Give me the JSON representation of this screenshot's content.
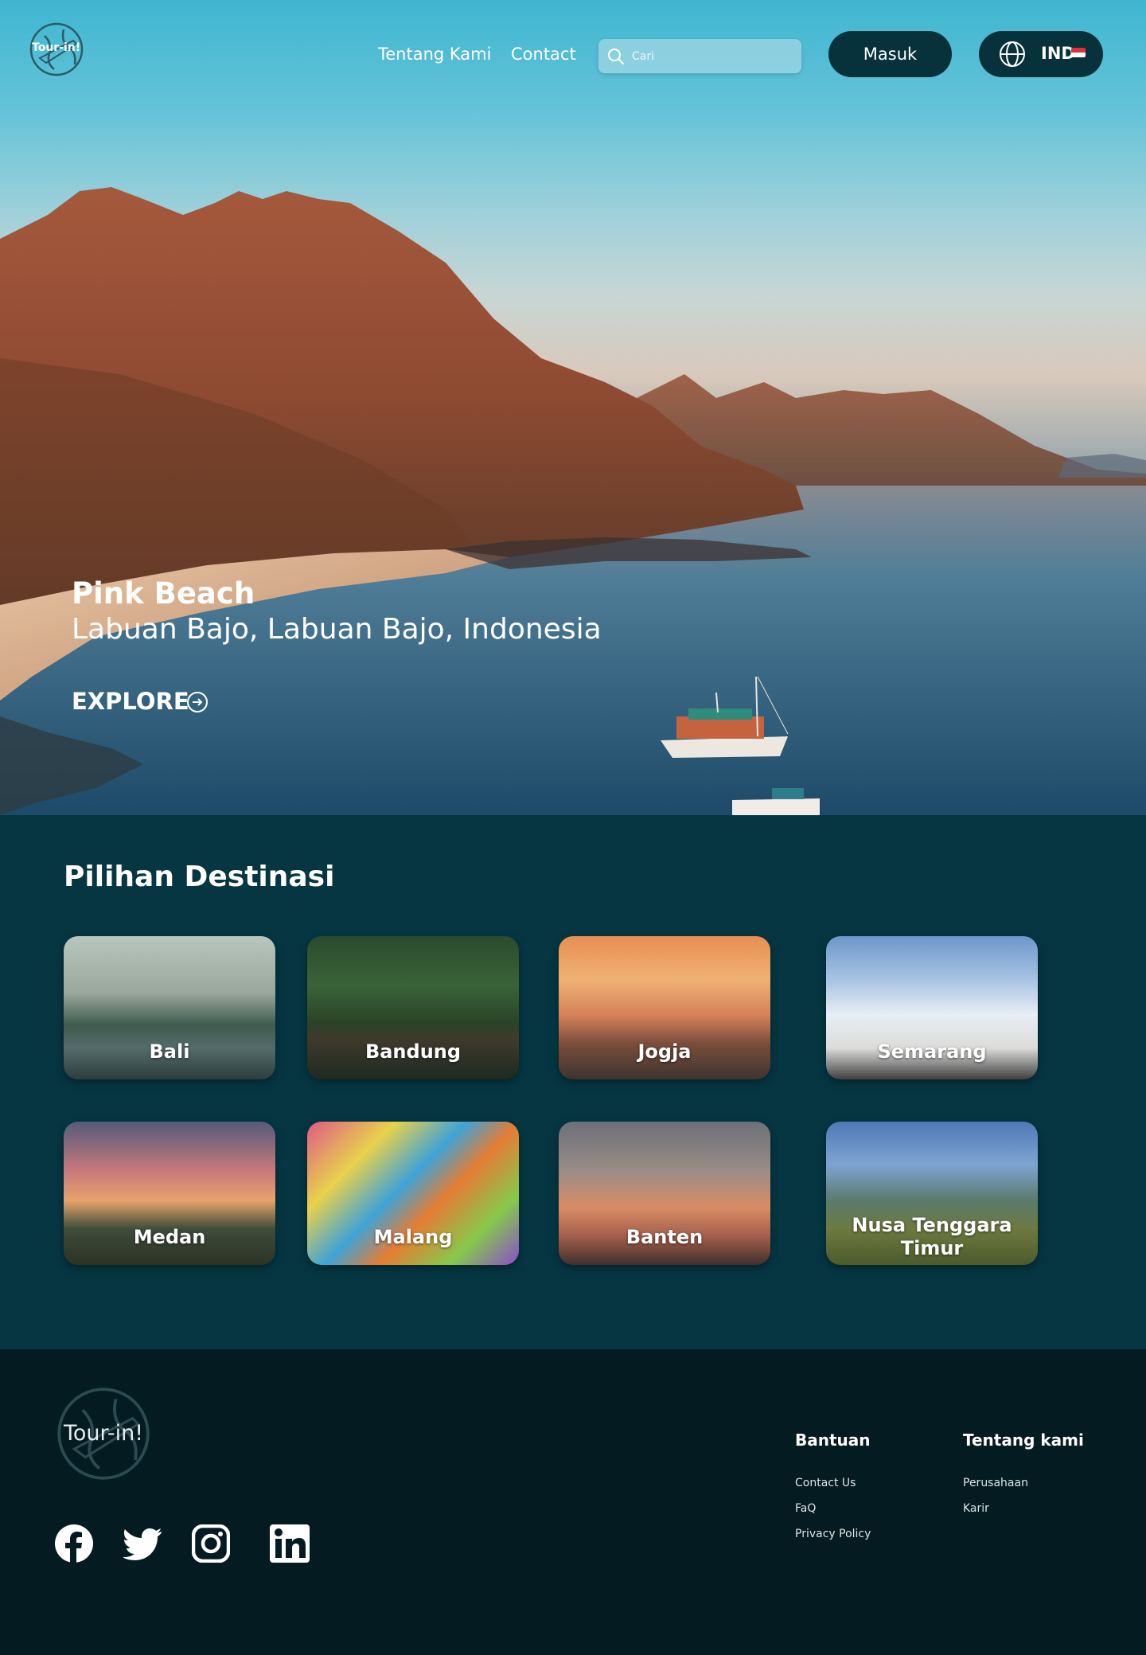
{
  "header": {
    "brand": "Tour-in!",
    "nav": [
      {
        "label": "Tentang Kami"
      },
      {
        "label": "Contact"
      }
    ],
    "search_placeholder": "Cari",
    "login_label": "Masuk",
    "language_label": "IND"
  },
  "hero": {
    "title": "Pink Beach",
    "location": "Labuan Bajo, Labuan Bajo, Indonesia",
    "cta": "EXPLORE"
  },
  "destinations": {
    "title": "Pilihan Destinasi",
    "items": [
      {
        "name": "Bali"
      },
      {
        "name": "Bandung"
      },
      {
        "name": "Jogja"
      },
      {
        "name": "Semarang"
      },
      {
        "name": "Medan"
      },
      {
        "name": "Malang"
      },
      {
        "name": "Banten"
      },
      {
        "name": "Nusa Tenggara Timur"
      }
    ]
  },
  "footer": {
    "brand": "Tour-in!",
    "social": [
      "facebook-icon",
      "twitter-icon",
      "instagram-icon",
      "linkedin-icon"
    ],
    "columns": [
      {
        "heading": "Bantuan",
        "links": [
          "Contact Us",
          "FaQ",
          "Privacy Policy"
        ]
      },
      {
        "heading": "Tentang kami",
        "links": [
          "Perusahaan",
          "Karir"
        ]
      }
    ]
  },
  "colors": {
    "primary_dark": "#07313b",
    "section_bg": "#053642",
    "footer_bg": "#041b21"
  }
}
